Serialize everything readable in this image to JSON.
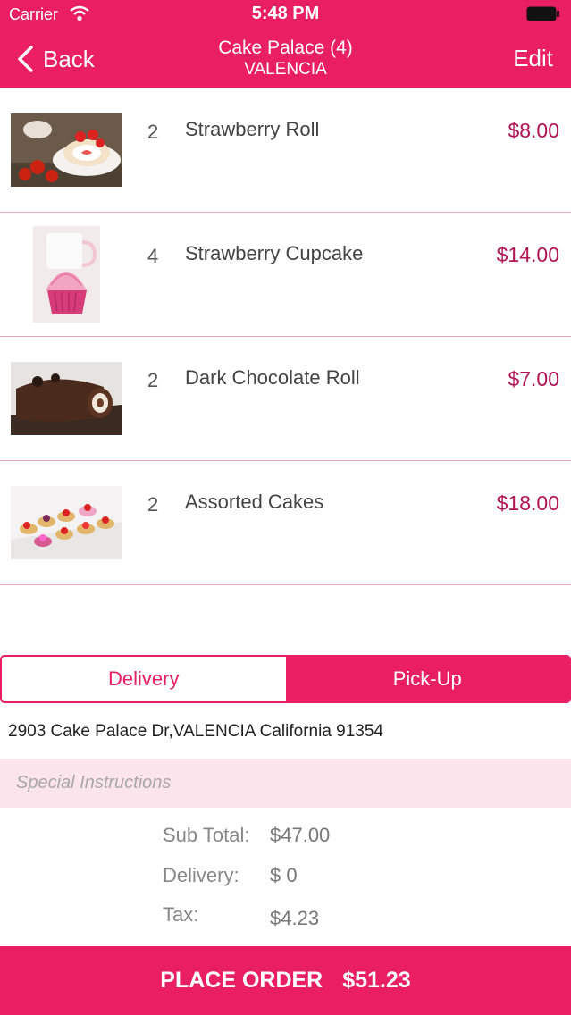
{
  "status": {
    "carrier": "Carrier",
    "time": "5:48 PM"
  },
  "nav": {
    "back_label": "Back",
    "title": "Cake Palace (4)",
    "subtitle": "VALENCIA",
    "edit_label": "Edit"
  },
  "items": [
    {
      "qty": "2",
      "name": "Strawberry Roll",
      "price": "$8.00"
    },
    {
      "qty": "4",
      "name": "Strawberry Cupcake",
      "price": "$14.00"
    },
    {
      "qty": "2",
      "name": "Dark Chocolate Roll",
      "price": "$7.00"
    },
    {
      "qty": "2",
      "name": "Assorted Cakes",
      "price": "$18.00"
    }
  ],
  "fulfillment": {
    "delivery_label": "Delivery",
    "pickup_label": "Pick-Up",
    "selected": "Pick-Up"
  },
  "address": "2903 Cake Palace Dr,VALENCIA California 91354",
  "instructions": {
    "placeholder": "Special Instructions",
    "value": ""
  },
  "summary": {
    "subtotal_label": "Sub Total:",
    "subtotal_value": "$47.00",
    "delivery_label": "Delivery:",
    "delivery_value": "$ 0",
    "tax_label": "Tax:",
    "tax_value": "$4.23"
  },
  "place_order": {
    "label": "PLACE ORDER",
    "total": "$51.23"
  },
  "colors": {
    "accent": "#e91e63",
    "price": "#b01455",
    "instructions_bg": "#fbe4ec"
  }
}
